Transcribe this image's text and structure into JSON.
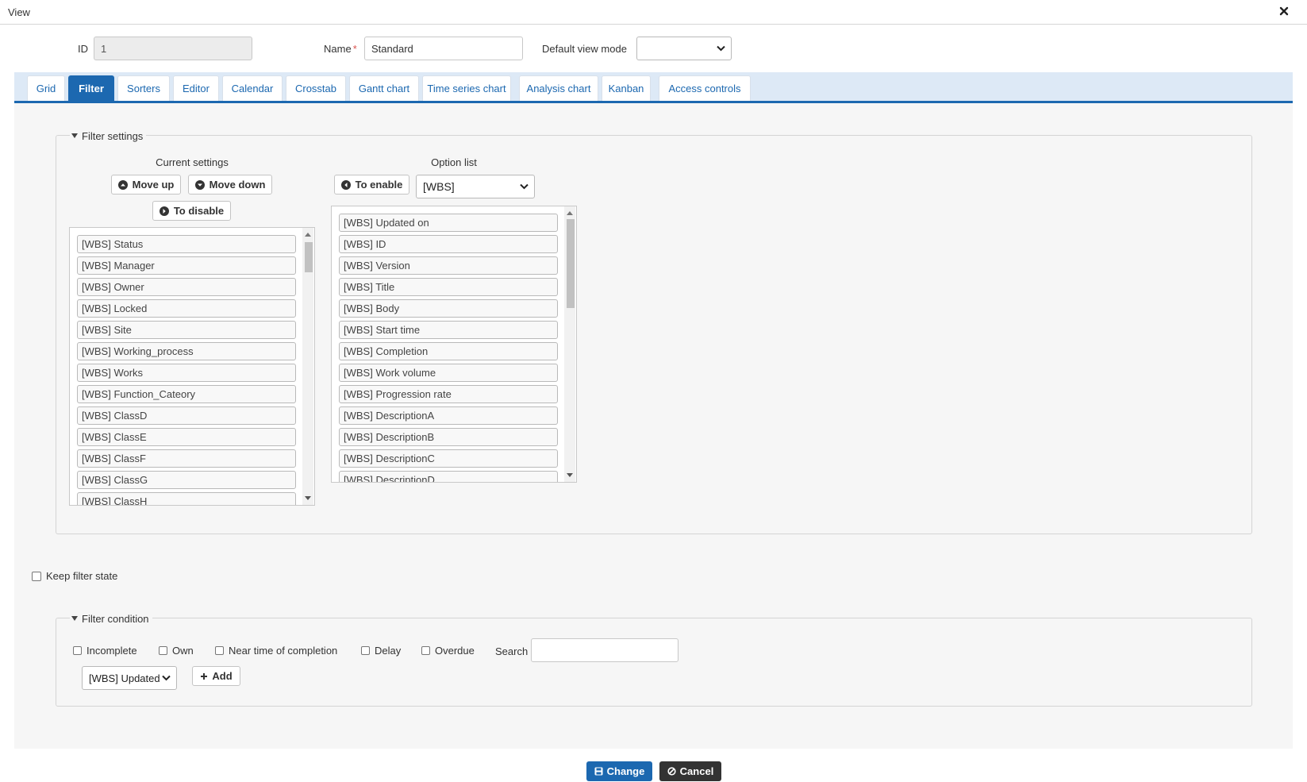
{
  "dialog": {
    "title": "View",
    "close_icon": "close-icon"
  },
  "header": {
    "id_label": "ID",
    "id_value": "1",
    "name_label": "Name",
    "name_required_mark": "*",
    "name_value": "Standard",
    "default_view_mode_label": "Default view mode",
    "default_view_mode_value": ""
  },
  "tabs": [
    {
      "label": "Grid"
    },
    {
      "label": "Filter",
      "active": true
    },
    {
      "label": "Sorters"
    },
    {
      "label": "Editor"
    },
    {
      "label": "Calendar"
    },
    {
      "label": "Crosstab"
    },
    {
      "label": "Gantt chart"
    },
    {
      "label": "Time series chart"
    },
    {
      "label": "Analysis chart"
    },
    {
      "label": "Kanban"
    },
    {
      "label": "Access controls"
    }
  ],
  "filter_settings": {
    "legend": "Filter settings",
    "current": {
      "heading": "Current settings",
      "move_up_label": "Move up",
      "move_down_label": "Move down",
      "to_disable_label": "To disable",
      "items": [
        "[WBS] Status",
        "[WBS] Manager",
        "[WBS] Owner",
        "[WBS] Locked",
        "[WBS] Site",
        "[WBS] Working_process",
        "[WBS] Works",
        "[WBS] Function_Cateory",
        "[WBS] ClassD",
        "[WBS] ClassE",
        "[WBS] ClassF",
        "[WBS] ClassG",
        "[WBS] ClassH"
      ]
    },
    "options": {
      "heading": "Option list",
      "to_enable_label": "To enable",
      "source_select_value": "[WBS]",
      "items": [
        "[WBS] Updated on",
        "[WBS] ID",
        "[WBS] Version",
        "[WBS] Title",
        "[WBS] Body",
        "[WBS] Start time",
        "[WBS] Completion",
        "[WBS] Work volume",
        "[WBS] Progression rate",
        "[WBS] DescriptionA",
        "[WBS] DescriptionB",
        "[WBS] DescriptionC",
        "[WBS] DescriptionD"
      ]
    }
  },
  "keep_filter_state_label": "Keep filter state",
  "filter_condition": {
    "legend": "Filter condition",
    "incomplete_label": "Incomplete",
    "own_label": "Own",
    "near_completion_label": "Near time of completion",
    "delay_label": "Delay",
    "overdue_label": "Overdue",
    "search_label": "Search",
    "search_value": "",
    "column_select_value": "[WBS] Updated",
    "add_label": "Add"
  },
  "footer": {
    "change_label": "Change",
    "cancel_label": "Cancel"
  },
  "colors": {
    "accent": "#1c68b0",
    "tab_bar_bg": "#dde9f6",
    "cancel_bg": "#333333",
    "required": "#d9534f"
  }
}
